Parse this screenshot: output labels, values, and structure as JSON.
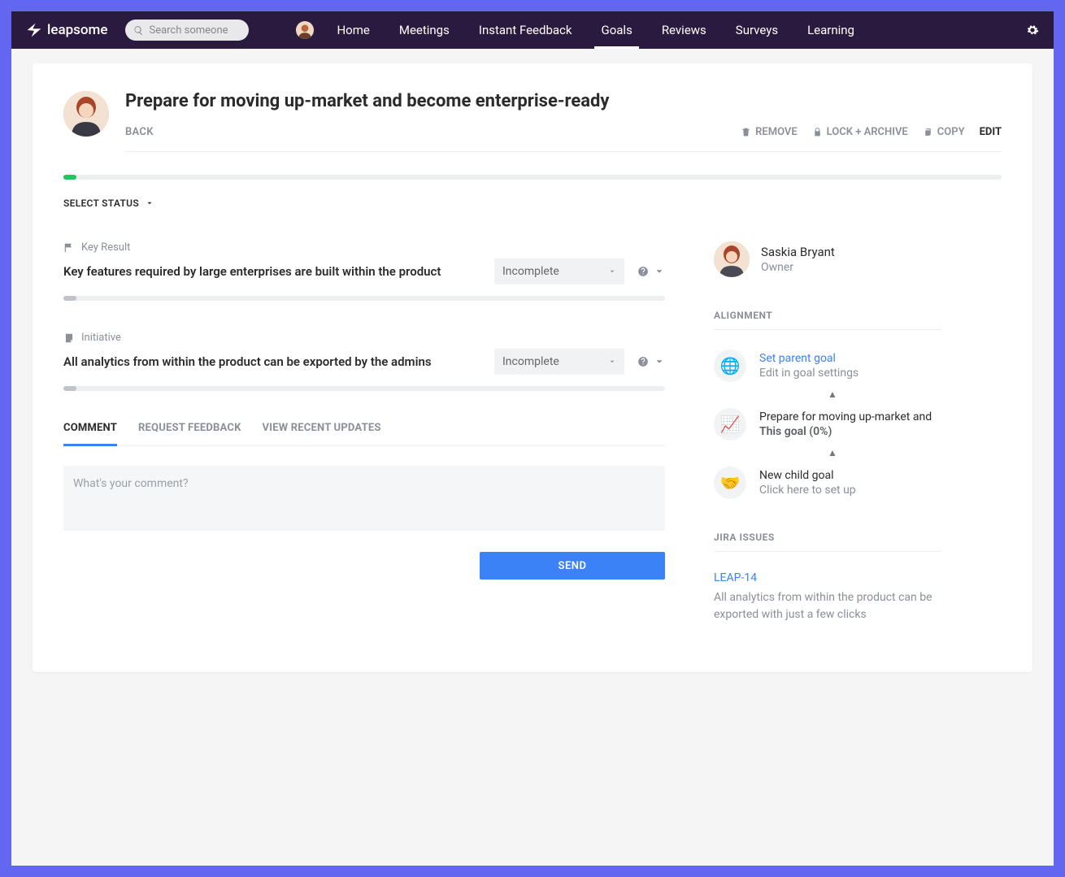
{
  "brand": "leapsome",
  "search_placeholder": "Search someone",
  "nav": {
    "items": [
      "Home",
      "Meetings",
      "Instant Feedback",
      "Goals",
      "Reviews",
      "Surveys",
      "Learning"
    ],
    "active_index": 3
  },
  "page": {
    "title": "Prepare for moving up-market and become enterprise-ready",
    "back_label": "BACK",
    "actions": {
      "remove": "REMOVE",
      "lock": "LOCK + ARCHIVE",
      "copy": "COPY",
      "edit": "EDIT"
    },
    "select_status_label": "SELECT STATUS"
  },
  "key_results": [
    {
      "type_label": "Key Result",
      "title": "Key features required by large enterprises are built within the product",
      "status": "Incomplete"
    },
    {
      "type_label": "Initiative",
      "title": "All analytics from within the product can be exported by the admins",
      "status": "Incomplete"
    }
  ],
  "tabs": {
    "items": [
      "COMMENT",
      "REQUEST FEEDBACK",
      "VIEW RECENT UPDATES"
    ],
    "active_index": 0
  },
  "comment": {
    "placeholder": "What's your comment?",
    "send_label": "SEND"
  },
  "owner": {
    "name": "Saskia Bryant",
    "role": "Owner"
  },
  "alignment": {
    "label": "ALIGNMENT",
    "parent": {
      "title": "Set parent goal",
      "subtitle": "Edit in goal settings"
    },
    "this": {
      "title": "Prepare for moving up-market and",
      "subtitle": "This goal (0%)"
    },
    "child": {
      "title": "New child goal",
      "subtitle": "Click here to set up"
    }
  },
  "jira": {
    "label": "JIRA ISSUES",
    "issue_key": "LEAP-14",
    "issue_desc": "All analytics from within the product can be exported with just a few clicks"
  }
}
